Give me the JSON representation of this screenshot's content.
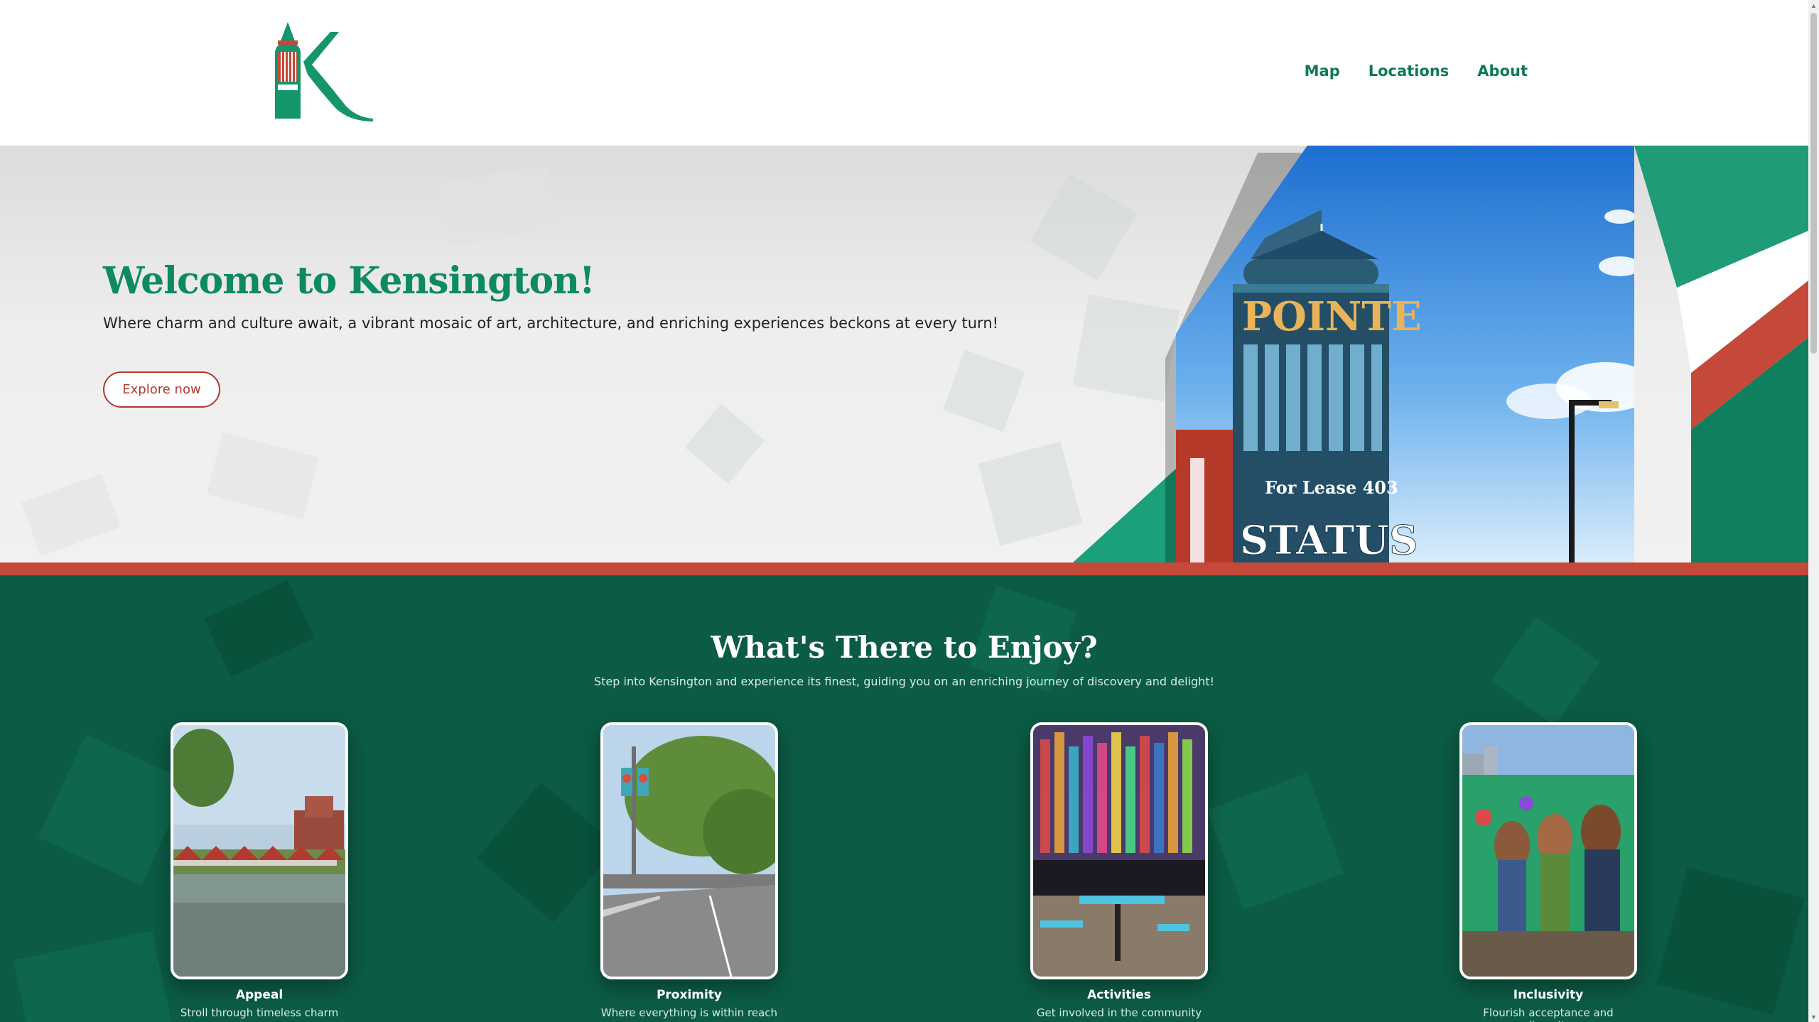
{
  "nav": {
    "items": [
      {
        "label": "Map"
      },
      {
        "label": "Locations"
      },
      {
        "label": "About"
      }
    ]
  },
  "hero": {
    "title": "Welcome to Kensington!",
    "subtitle": "Where charm and culture await, a vibrant mosaic of art, architecture, and enriching experiences beckons at every turn!",
    "button_label": "Explore now",
    "photo_sign_top": "POINTE",
    "photo_sign_lease": "For Lease 403",
    "photo_sign_bottom": "STATUS"
  },
  "enjoy": {
    "title": "What's There to Enjoy?",
    "subtitle": "Step into Kensington and experience its finest, guiding you on an enriching journey of discovery and delight!",
    "cards": [
      {
        "title": "Appeal",
        "desc": "Stroll through timeless charm"
      },
      {
        "title": "Proximity",
        "desc": "Where everything is within reach"
      },
      {
        "title": "Activities",
        "desc": "Get involved in the community"
      },
      {
        "title": "Inclusivity",
        "desc": "Flourish acceptance and diversity"
      }
    ]
  },
  "colors": {
    "brand_green": "#0e8a5f",
    "accent_red": "#c4493a",
    "section_green": "#0b5b45"
  }
}
